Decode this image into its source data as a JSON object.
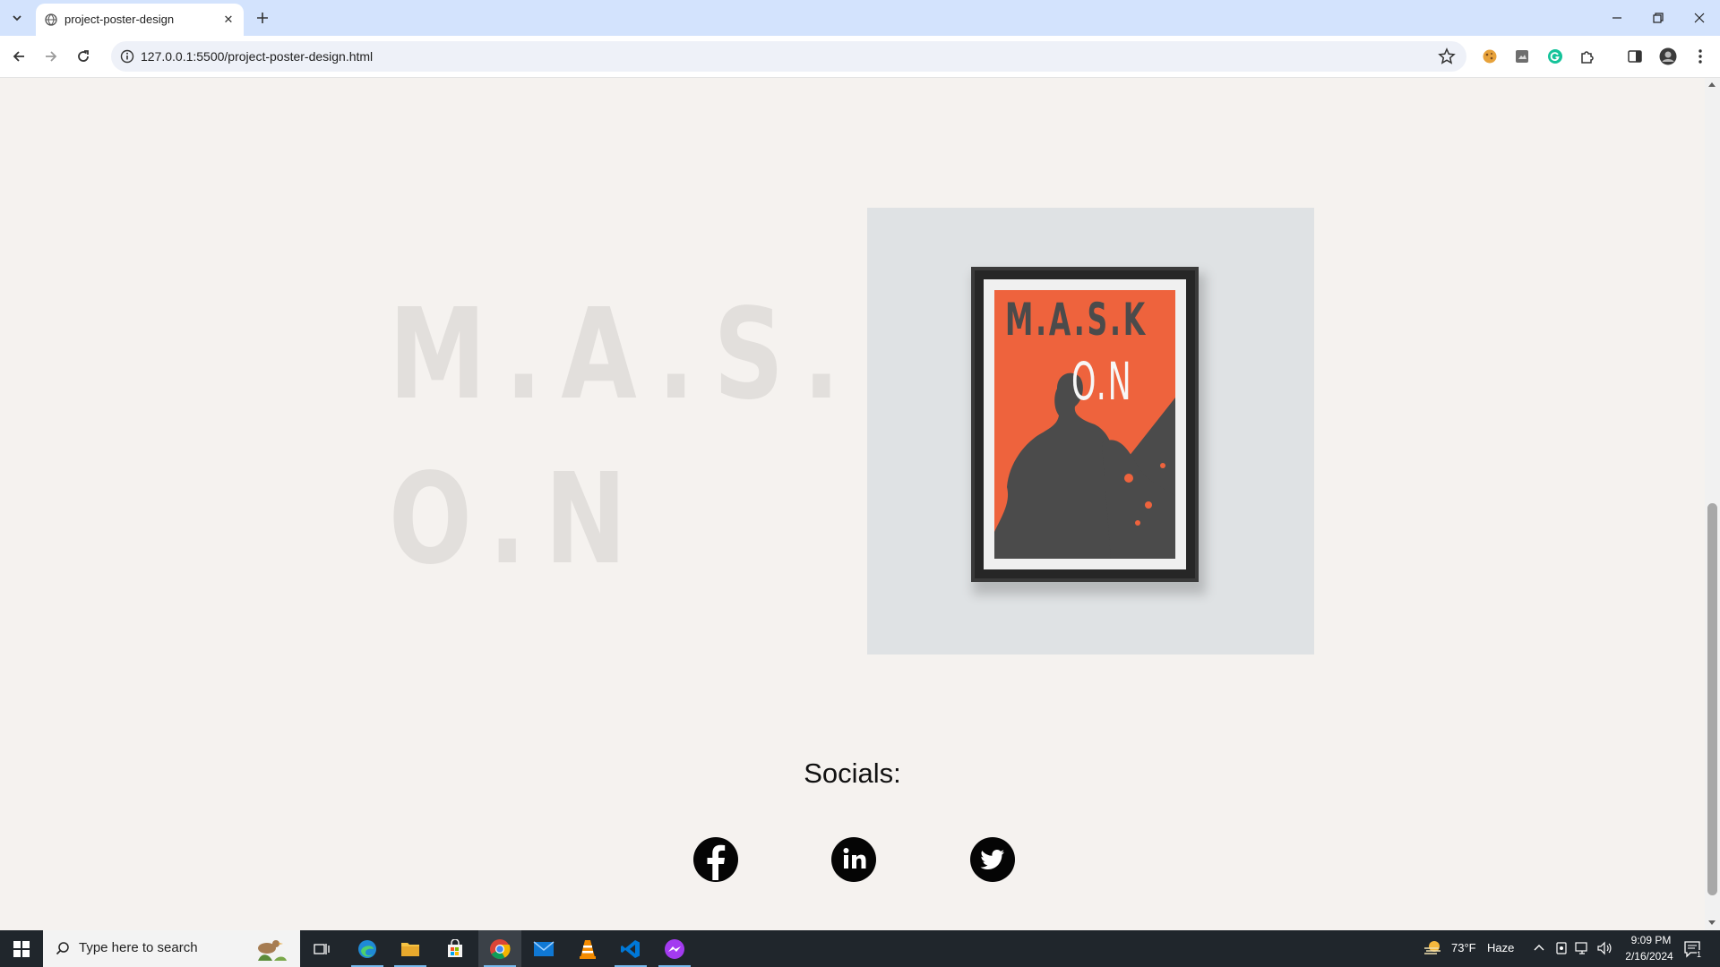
{
  "browser": {
    "tab_title": "project-poster-design",
    "url": "127.0.0.1:5500/project-poster-design.html"
  },
  "page": {
    "heading_line1": "M.A.S.K",
    "heading_line2": "O.N",
    "poster_text_top": "M.A.S.K",
    "poster_text_mid": "O.N",
    "socials_label": "Socials:",
    "socials": [
      {
        "name": "Facebook",
        "icon": "facebook-icon"
      },
      {
        "name": "LinkedIn",
        "icon": "linkedin-icon"
      },
      {
        "name": "Twitter",
        "icon": "twitter-icon"
      }
    ]
  },
  "taskbar": {
    "search_placeholder": "Type here to search",
    "weather_temp": "73°F",
    "weather_desc": "Haze",
    "time": "9:09 PM",
    "date": "2/16/2024",
    "notification_count": "1"
  },
  "colors": {
    "page_bg": "#f5f2ef",
    "poster_orange": "#ee633d",
    "poster_gray": "#4b4b4b",
    "heading_gray": "#e2dfdc"
  }
}
